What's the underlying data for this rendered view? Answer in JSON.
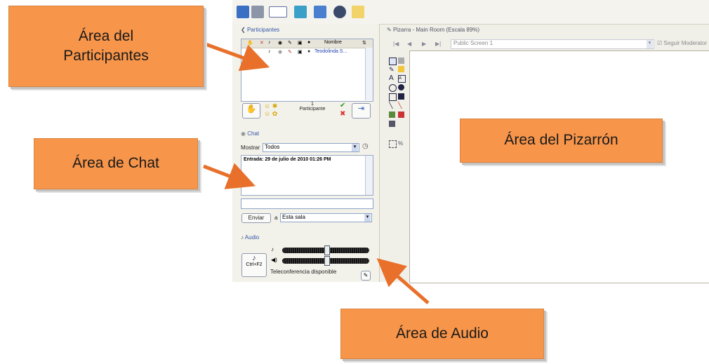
{
  "window": {
    "whiteboard_title": "Pizarra - Main Room (Escala 89%)",
    "screen_select": "Public Screen 1",
    "follow_moderator": "Seguir Moderator"
  },
  "participants": {
    "section_title": "Participantes",
    "name_column": "Nombre",
    "sort_icon": "⇅",
    "rows": [
      {
        "name": "Teodolinda S..."
      }
    ],
    "count": "1",
    "count_label": "Participante"
  },
  "chat": {
    "section_title": "Chat",
    "show_label": "Mostrar",
    "show_value": "Todos",
    "entry": "Entrada: 29 de julio de 2010 01:26 PM",
    "send_button": "Enviar",
    "to_label": "a",
    "to_value": "Esta sala"
  },
  "audio": {
    "section_title": "Audio",
    "shortcut": "Ctrl+F2",
    "status": "Teleconferencia disponible",
    "mic_level": 0.48,
    "speaker_level": 0.48
  },
  "callouts": {
    "participants_line1": "Área del",
    "participants_line2": "Participantes",
    "chat": "Área de Chat",
    "whiteboard": "Área del Pizarrón",
    "audio": "Área de Audio"
  },
  "colors": {
    "callout_fill": "#f7954a",
    "arrow": "#e8702a",
    "link_blue": "#1f3fb0"
  }
}
